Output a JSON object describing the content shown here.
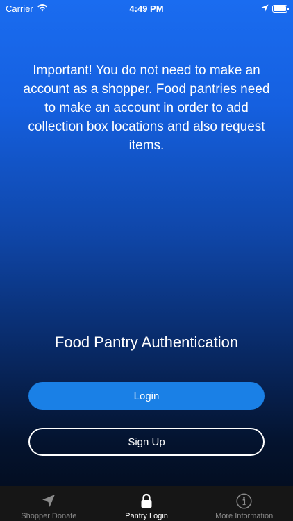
{
  "status_bar": {
    "carrier": "Carrier",
    "time": "4:49 PM"
  },
  "notice": "Important! You do not need to make an account as a shopper. Food pantries need to make an account in order to add collection box locations and also request items.",
  "auth": {
    "title": "Food Pantry Authentication",
    "login_label": "Login",
    "signup_label": "Sign Up"
  },
  "tabs": [
    {
      "label": "Shopper Donate",
      "icon": "location-arrow-icon",
      "active": false
    },
    {
      "label": "Pantry Login",
      "icon": "lock-icon",
      "active": true
    },
    {
      "label": "More Information",
      "icon": "info-icon",
      "active": false
    }
  ],
  "colors": {
    "login_button": "#1a80e6",
    "gradient_top": "#1a6cf0",
    "gradient_bottom": "#020a18"
  }
}
